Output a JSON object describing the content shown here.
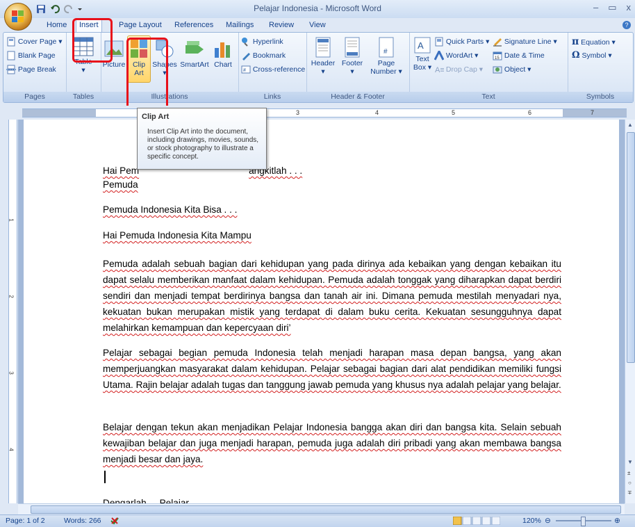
{
  "window": {
    "title": "Pelajar Indonesia - Microsoft Word",
    "minimize": "–",
    "maximize": "▭",
    "close": "x"
  },
  "tabs": [
    "Home",
    "Insert",
    "Page Layout",
    "References",
    "Mailings",
    "Review",
    "View"
  ],
  "active_tab": "Insert",
  "groups": {
    "pages": {
      "label": "Pages",
      "items": [
        "Cover Page ▾",
        "Blank Page",
        "Page Break"
      ]
    },
    "tables": {
      "label": "Tables",
      "table": "Table"
    },
    "illustrations": {
      "label": "Illustrations",
      "picture": "Picture",
      "clip_art_line1": "Clip",
      "clip_art_line2": "Art",
      "shapes": "Shapes",
      "smartart": "SmartArt",
      "chart": "Chart"
    },
    "links": {
      "label": "Links",
      "hyperlink": "Hyperlink",
      "bookmark": "Bookmark",
      "cross_reference": "Cross-reference"
    },
    "header_footer": {
      "label": "Header & Footer",
      "header": "Header",
      "footer": "Footer",
      "page_number_line1": "Page",
      "page_number_line2": "Number ▾"
    },
    "text": {
      "label": "Text",
      "textbox_line1": "Text",
      "textbox_line2": "Box ▾",
      "quick_parts": "Quick Parts ▾",
      "wordart": "WordArt ▾",
      "drop_cap": "Drop Cap ▾",
      "signature_line": "Signature Line ▾",
      "date_time": "Date & Time",
      "object": "Object ▾"
    },
    "symbols": {
      "label": "Symbols",
      "equation": "Equation ▾",
      "symbol": "Symbol ▾"
    }
  },
  "ruler_numbers": [
    "1",
    "2",
    "3",
    "4",
    "5",
    "6",
    "7"
  ],
  "tooltip": {
    "title": "Clip Art",
    "body": "Insert Clip Art into the document, including drawings, movies, sounds, or stock photography to illustrate a specific concept."
  },
  "document": {
    "line1": "Hai Pemuda Indonesia Bangkitlah . . .",
    "line1_visible_start": "Hai Pem",
    "line1_visible_end": "angkitlah . . .",
    "line2_visible": "Pemuda",
    "para_bisa": "Pemuda Indonesia Kita Bisa . . .",
    "para_mampu": "Hai Pemuda Indonesia Kita Mampu",
    "para1": "Pemuda adalah sebuah bagian dari kehidupan yang pada dirinya ada kebaikan yang dengan kebaikan itu dapat selalu memberikan manfaat dalam kehidupan. Pemuda adalah tonggak yang diharapkan dapat berdiri sendiri dan menjadi tempat berdirinya bangsa dan tanah air ini. Dimana pemuda mestilah menyadari nya, kekuatan bukan merupakan mistik yang terdapat di dalam buku cerita. Kekuatan sesungguhnya dapat melahirkan kemampuan dan kepercyaan diri’",
    "para2": "Pelajar sebagai begian pemuda Indonesia telah menjadi harapan masa depan bangsa, yang akan memperjuangkan masyarakat dalam kehidupan. Pelajar sebagai bagian dari alat pendidikan memiliki fungsi Utama. Rajin belajar adalah tugas dan tanggung jawab pemuda yang khusus nya adalah pelajar yang belajar.",
    "para3": "Belajar dengan tekun akan menjadikan Pelajar Indonesia bangga akan diri dan bangsa kita. Selain sebuah kewajiban belajar dan juga menjadi harapan, pemuda juga adalah diri pribadi yang akan membawa bangsa menjadi besar dan jaya.",
    "last_line": "Dengarlah ... Pelajar"
  },
  "status": {
    "page": "Page: 1 of 2",
    "words": "Words: 266",
    "zoom": "120%"
  },
  "colors": {
    "highlight": "#e8101a",
    "ribbon_text": "#15428b",
    "title_text": "#3e5780"
  }
}
